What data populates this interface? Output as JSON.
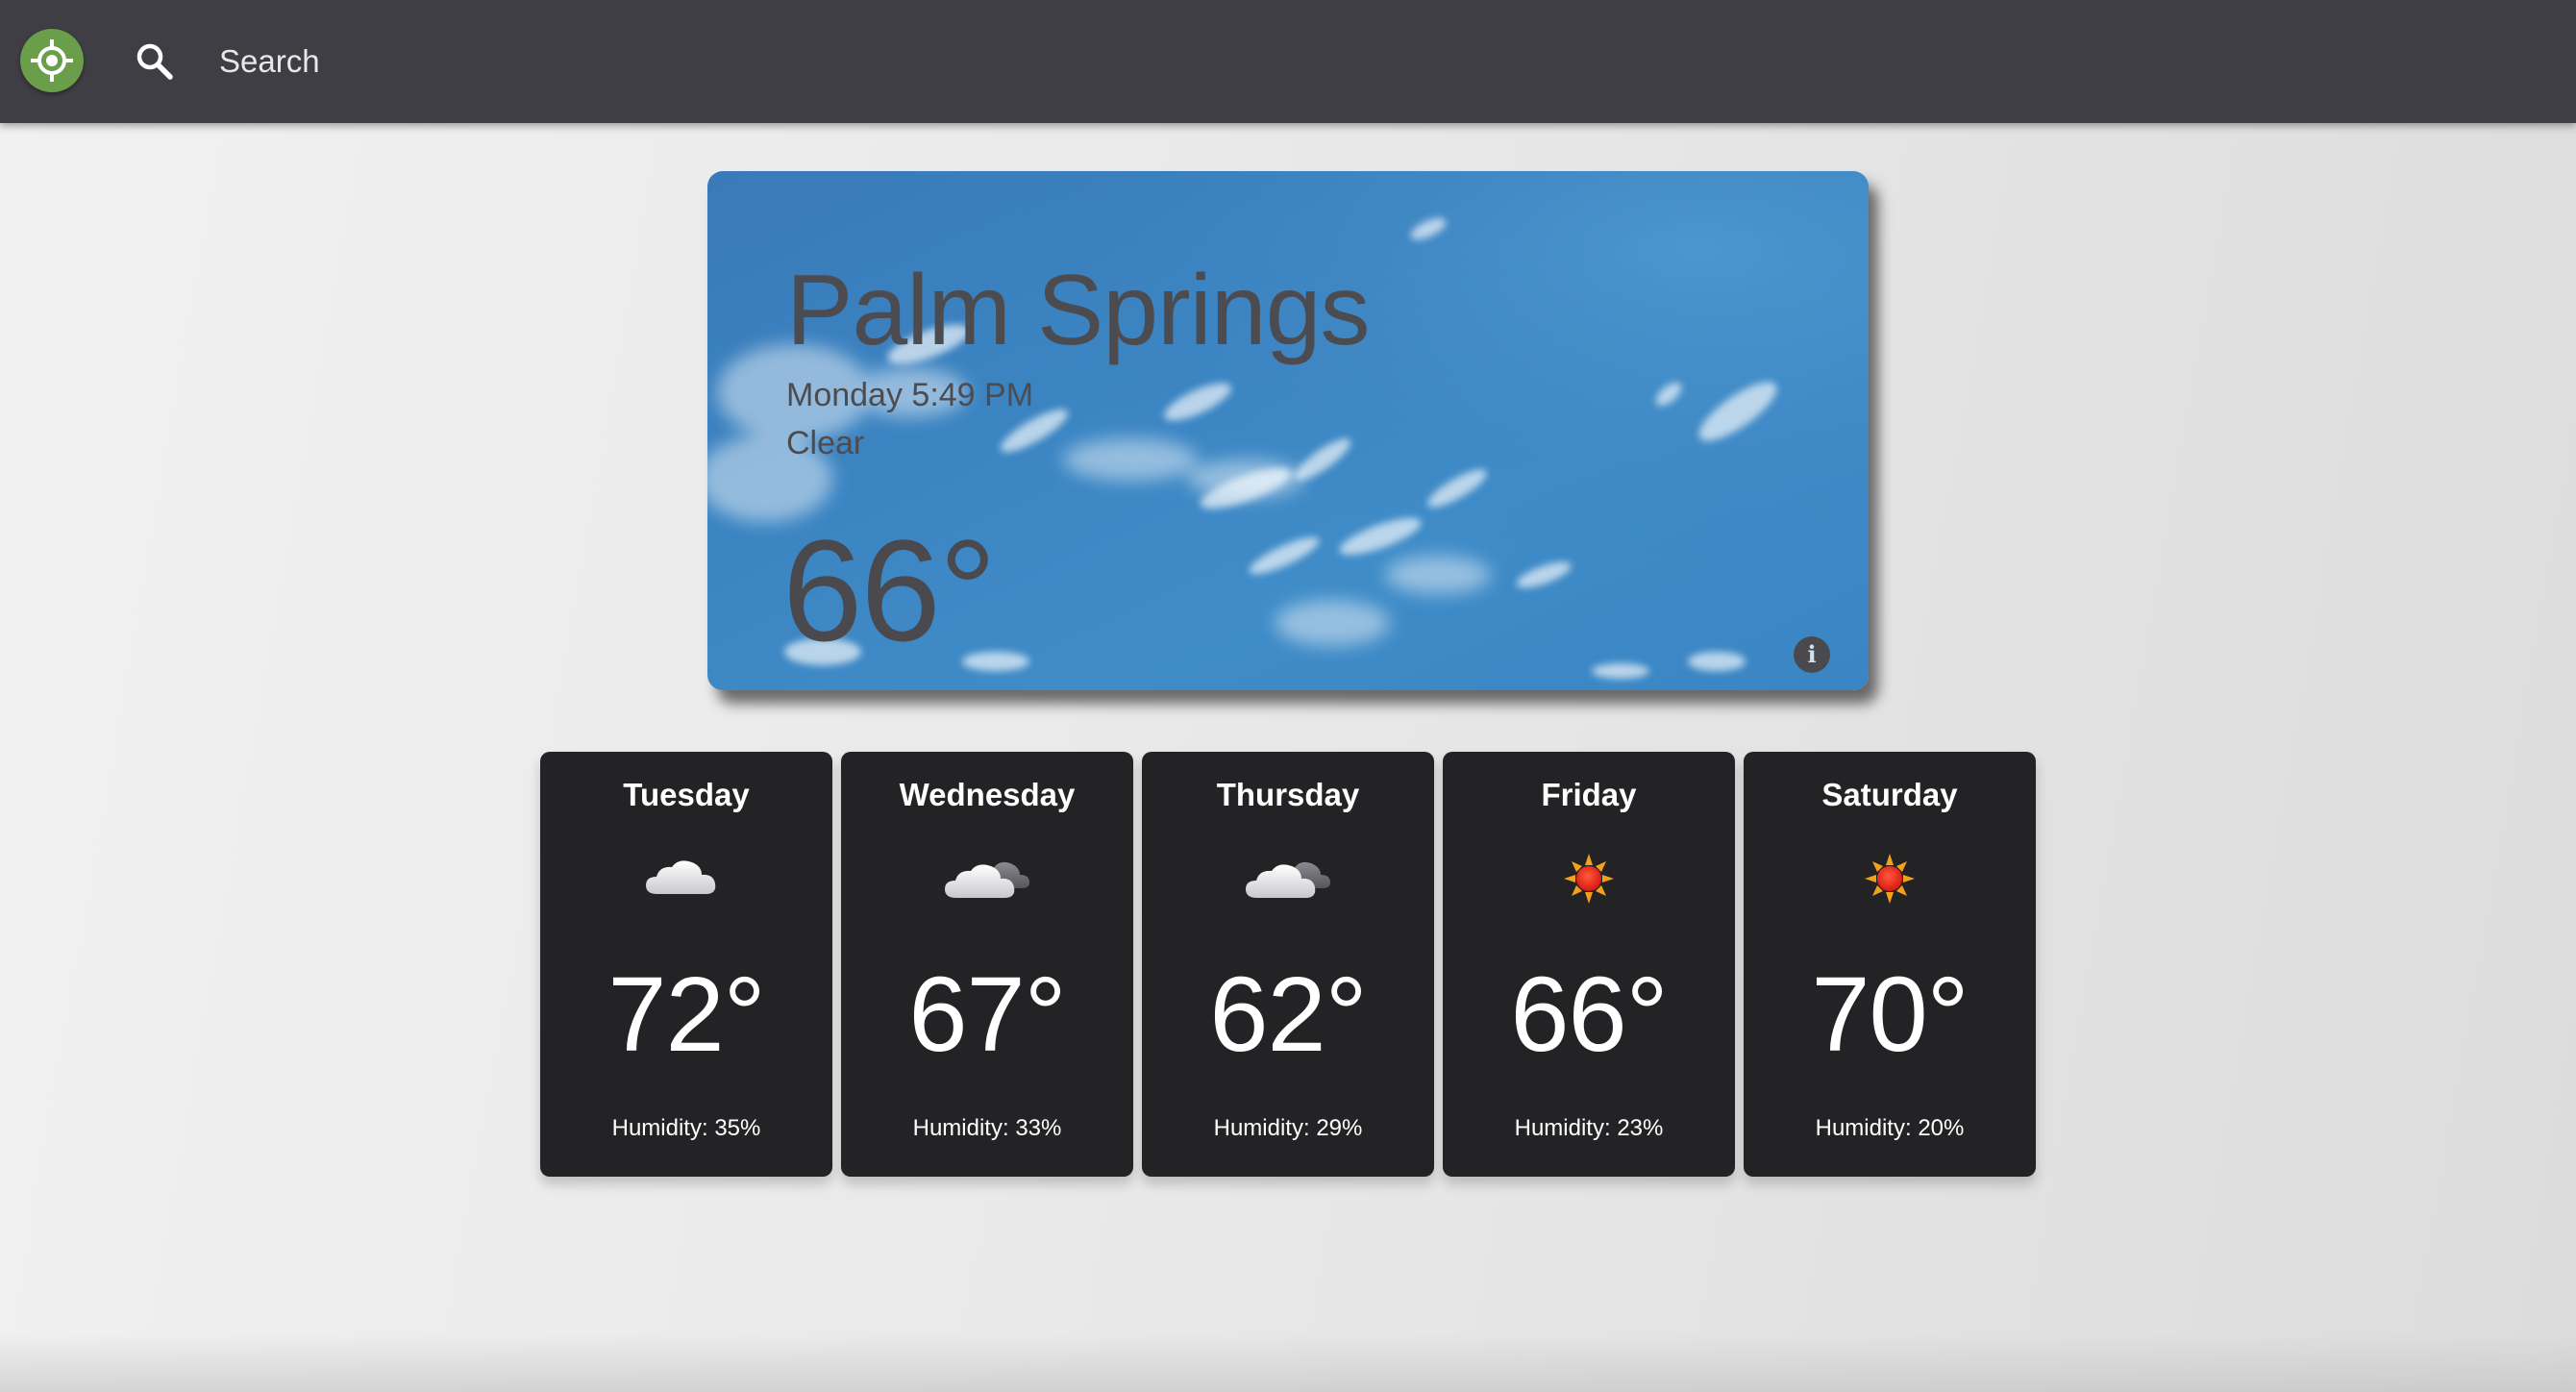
{
  "search": {
    "placeholder": "Search"
  },
  "current": {
    "city": "Palm Springs",
    "datetime": "Monday 5:49 PM",
    "condition": "Clear",
    "temperature": "66°",
    "info_label": "i"
  },
  "forecast": [
    {
      "day": "Tuesday",
      "temp": "72°",
      "humidity": "Humidity: 35%",
      "icon": "cloud-icon"
    },
    {
      "day": "Wednesday",
      "temp": "67°",
      "humidity": "Humidity: 33%",
      "icon": "cloudy-icon"
    },
    {
      "day": "Thursday",
      "temp": "62°",
      "humidity": "Humidity: 29%",
      "icon": "cloudy-icon"
    },
    {
      "day": "Friday",
      "temp": "66°",
      "humidity": "Humidity: 23%",
      "icon": "sun-icon"
    },
    {
      "day": "Saturday",
      "temp": "70°",
      "humidity": "Humidity: 20%",
      "icon": "sun-icon"
    }
  ],
  "colors": {
    "topbar": "#3f3e44",
    "locate_button": "#6a9e4a",
    "card_dark": "#232224",
    "sky_blue": "#3b84c2",
    "sun_red": "#e8271d",
    "sun_orange": "#f4a21c"
  }
}
